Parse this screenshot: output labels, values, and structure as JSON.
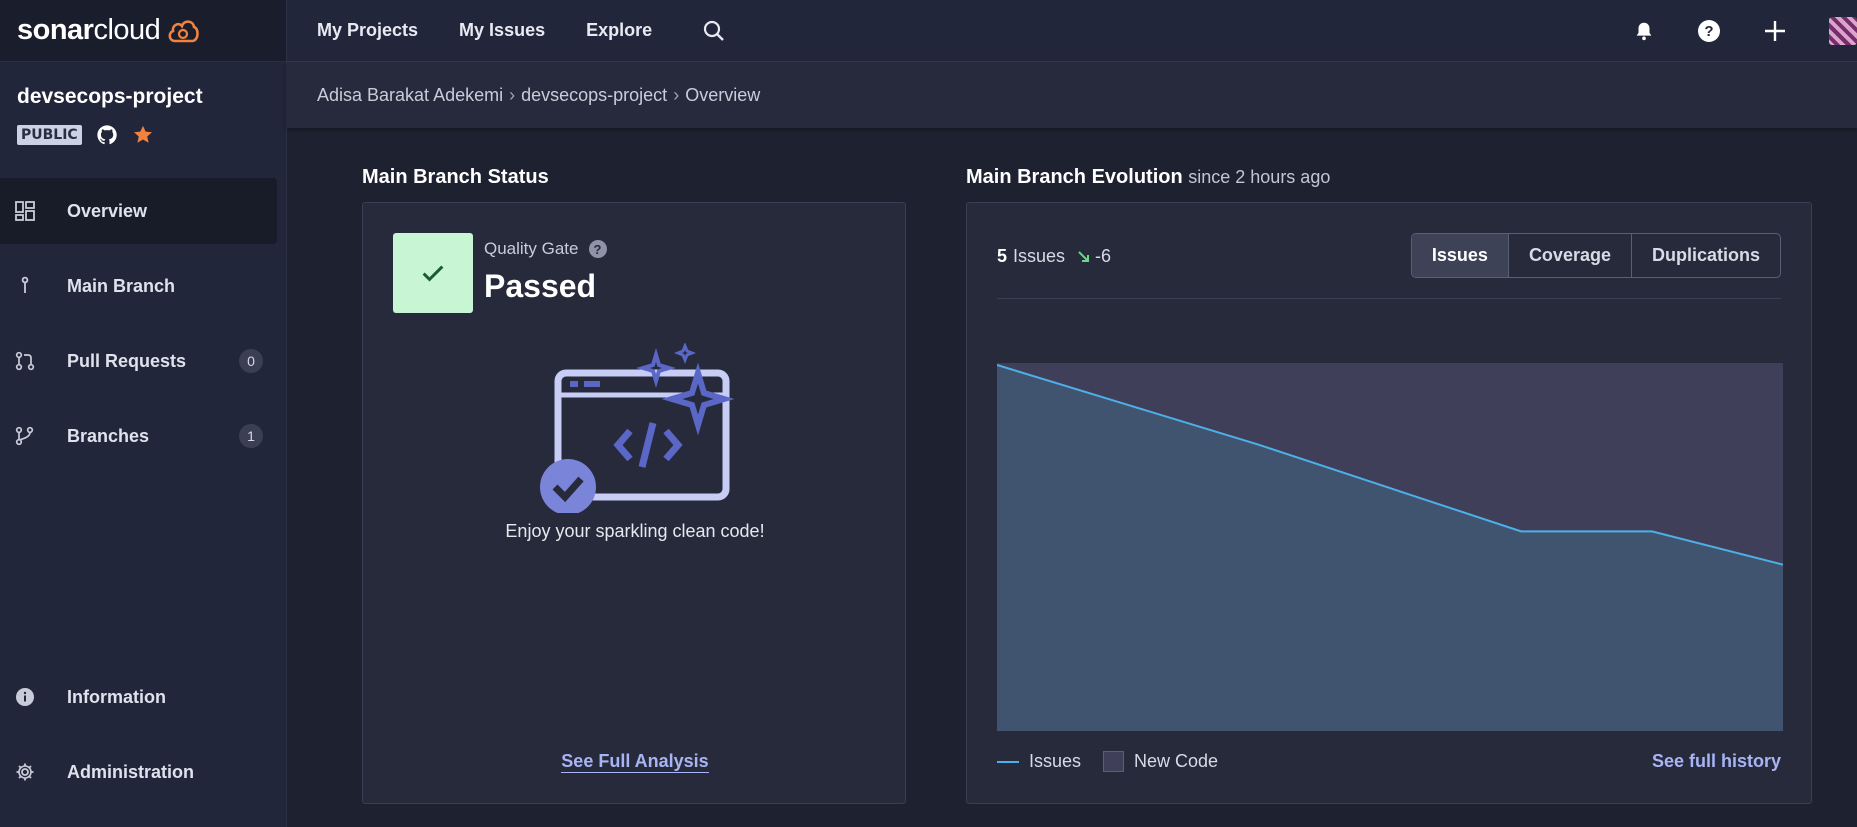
{
  "brand": {
    "name_bold": "sonar",
    "name_light": "cloud"
  },
  "project": {
    "name": "devsecops-project",
    "visibility": "PUBLIC"
  },
  "sidebar": {
    "items": [
      {
        "label": "Overview",
        "icon": "overview-grid-icon",
        "active": true
      },
      {
        "label": "Main Branch",
        "icon": "branch-line-icon"
      },
      {
        "label": "Pull Requests",
        "icon": "pull-request-icon",
        "count": "0"
      },
      {
        "label": "Branches",
        "icon": "branches-icon",
        "count": "1"
      }
    ],
    "bottom": [
      {
        "label": "Information",
        "icon": "info-icon"
      },
      {
        "label": "Administration",
        "icon": "gear-icon"
      }
    ]
  },
  "topnav": {
    "projects": "My Projects",
    "issues": "My Issues",
    "explore": "Explore"
  },
  "breadcrumb": [
    "Adisa Barakat Adekemi",
    "devsecops-project",
    "Overview"
  ],
  "status": {
    "title": "Main Branch Status",
    "qg_label": "Quality Gate",
    "qg_value": "Passed",
    "message": "Enjoy your sparkling clean code!",
    "link": "See Full Analysis"
  },
  "evolution": {
    "title": "Main Branch Evolution",
    "subtitle": "since 2 hours ago",
    "count": "5",
    "count_label": "Issues",
    "delta": "-6",
    "tabs": [
      "Issues",
      "Coverage",
      "Duplications"
    ],
    "legend_issues": "Issues",
    "legend_new_code": "New Code",
    "history_link": "See full history"
  },
  "colors": {
    "accent_link": "#a9b4f5",
    "qg_passed": "#c8f5d4",
    "line": "#4db0e8",
    "brand_orange": "#f4823f"
  },
  "chart_data": {
    "type": "area",
    "series": [
      {
        "name": "Issues",
        "values": [
          11,
          9.8,
          8.6,
          7.3,
          6,
          6,
          5
        ]
      }
    ],
    "x": [
      0,
      1,
      2,
      3,
      4,
      5,
      6
    ],
    "ylim": [
      0,
      11
    ],
    "new_code_shaded": true,
    "grid": false
  }
}
